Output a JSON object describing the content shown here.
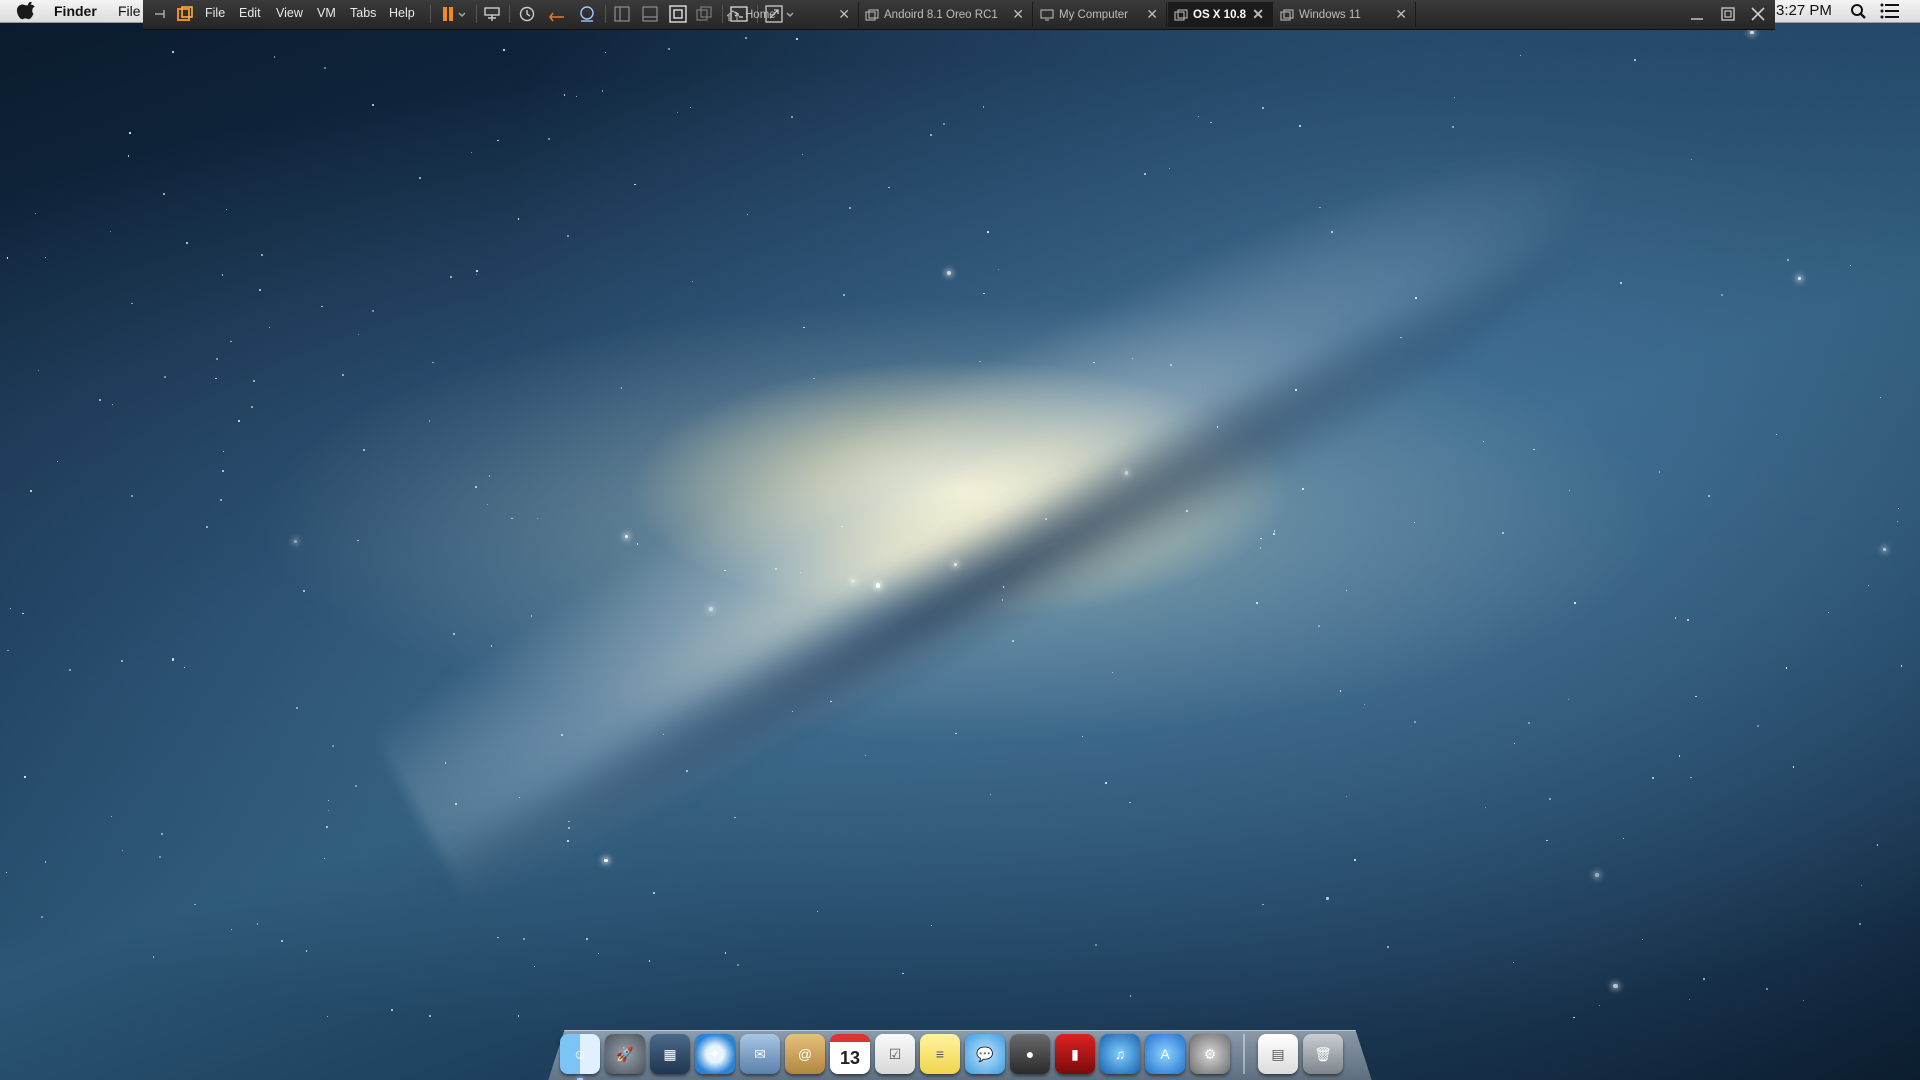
{
  "menubar": {
    "app_name": "Finder",
    "file_partial": "File",
    "clock": "3:27 PM"
  },
  "vmware": {
    "menus": [
      "File",
      "Edit",
      "View",
      "VM",
      "Tabs",
      "Help"
    ],
    "tabs": [
      {
        "label": "Home",
        "icon": "home-icon",
        "active": false
      },
      {
        "label": "Andoird 8.1 Oreo RC1",
        "icon": "vm-icon",
        "active": false
      },
      {
        "label": "My Computer",
        "icon": "monitor-icon",
        "active": false
      },
      {
        "label": "OS X 10.8",
        "icon": "vm-icon",
        "active": true
      },
      {
        "label": "Windows 11",
        "icon": "vm-icon",
        "active": false
      }
    ],
    "colors": {
      "bar": "#2e2e2e",
      "pause_accent": "#f08a24",
      "active_tab": "#1b1b1b"
    }
  },
  "dock": {
    "items": [
      {
        "name": "finder",
        "icon": "finder-icon",
        "running": true
      },
      {
        "name": "launchpad",
        "icon": "rocket-icon",
        "running": false
      },
      {
        "name": "mission-control",
        "icon": "mission-control-icon",
        "running": false
      },
      {
        "name": "safari",
        "icon": "compass-icon",
        "running": false
      },
      {
        "name": "mail",
        "icon": "mail-stamp-icon",
        "running": false
      },
      {
        "name": "contacts",
        "icon": "address-book-icon",
        "running": false
      },
      {
        "name": "calendar",
        "icon": "calendar-icon",
        "running": false,
        "text": "13"
      },
      {
        "name": "reminders",
        "icon": "checklist-icon",
        "running": false
      },
      {
        "name": "notes",
        "icon": "notes-icon",
        "running": false
      },
      {
        "name": "messages",
        "icon": "speech-bubble-icon",
        "running": false
      },
      {
        "name": "facetime",
        "icon": "video-camera-icon",
        "running": false
      },
      {
        "name": "photo-booth",
        "icon": "photo-booth-icon",
        "running": false
      },
      {
        "name": "itunes",
        "icon": "music-note-icon",
        "running": false
      },
      {
        "name": "app-store",
        "icon": "app-store-icon",
        "running": false
      },
      {
        "name": "system-preferences",
        "icon": "gear-icon",
        "running": false
      },
      {
        "name": "documents",
        "icon": "document-icon",
        "running": false
      },
      {
        "name": "trash",
        "icon": "trash-icon",
        "running": false
      }
    ]
  }
}
